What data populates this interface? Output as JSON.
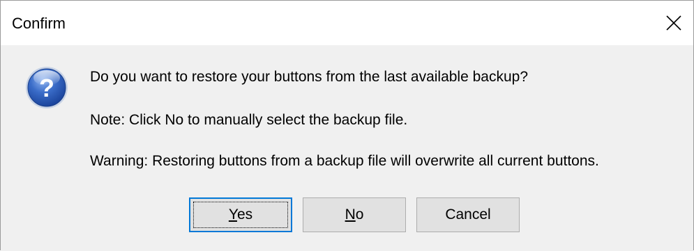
{
  "window": {
    "title": "Confirm",
    "close_icon": "close-icon"
  },
  "message": {
    "icon": "question-icon",
    "line1": "Do you want to restore your buttons from the last available backup?",
    "line2": "Note: Click No to manually select the backup file.",
    "line3": "Warning: Restoring buttons from a backup file will overwrite all current buttons."
  },
  "buttons": {
    "yes": {
      "mnemonic": "Y",
      "rest": "es",
      "focused": true
    },
    "no": {
      "mnemonic": "N",
      "rest": "o"
    },
    "cancel": {
      "label": "Cancel"
    }
  },
  "colors": {
    "focus_border": "#0078d7",
    "button_face": "#e1e1e1",
    "dialog_background": "#f0f0f0",
    "icon_blue": "#1f4fa8"
  }
}
